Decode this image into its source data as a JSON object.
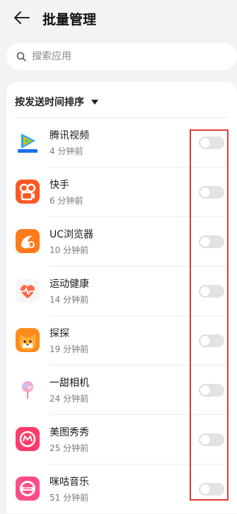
{
  "header": {
    "title": "批量管理",
    "back_icon": "arrow-left-icon"
  },
  "search": {
    "placeholder": "搜索应用",
    "value": "",
    "icon": "search-icon"
  },
  "sort": {
    "label": "按发送时间排序",
    "icon": "caret-down-icon"
  },
  "apps": [
    {
      "name": "腾讯视频",
      "time": "4 分钟前",
      "icon": "tencent-video-icon",
      "enabled": false
    },
    {
      "name": "快手",
      "time": "6 分钟前",
      "icon": "kuaishou-icon",
      "enabled": false
    },
    {
      "name": "UC浏览器",
      "time": "10 分钟前",
      "icon": "uc-browser-icon",
      "enabled": false
    },
    {
      "name": "运动健康",
      "time": "14 分钟前",
      "icon": "health-icon",
      "enabled": false
    },
    {
      "name": "探探",
      "time": "19 分钟前",
      "icon": "tantan-icon",
      "enabled": false
    },
    {
      "name": "一甜相机",
      "time": "24 分钟前",
      "icon": "yitian-camera-icon",
      "enabled": false
    },
    {
      "name": "美图秀秀",
      "time": "25 分钟前",
      "icon": "meitu-icon",
      "enabled": false
    },
    {
      "name": "咪咕音乐",
      "time": "51 分钟前",
      "icon": "migu-music-icon",
      "enabled": false
    }
  ],
  "colors": {
    "background": "#f1f3f5",
    "toggle_off": "#e3e3e3",
    "highlight": "#e53935"
  }
}
